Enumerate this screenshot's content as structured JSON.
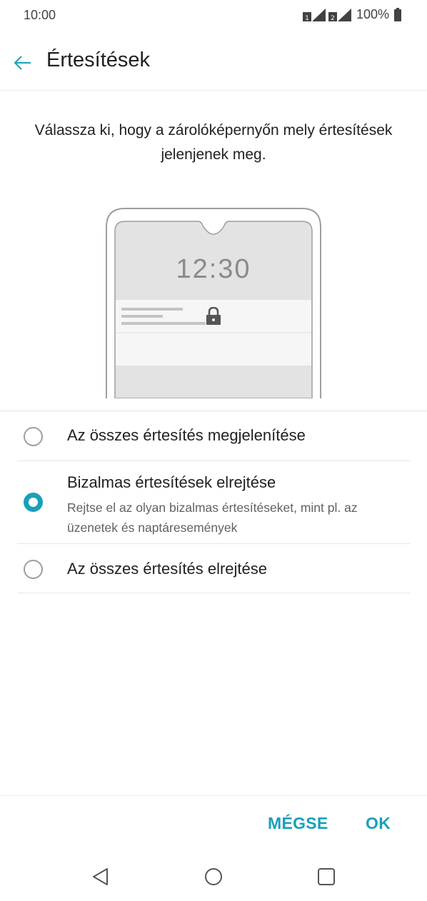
{
  "status_bar": {
    "time": "10:00",
    "sim1_label": "1",
    "sim2_label": "2",
    "battery": "100%",
    "icons": [
      "sim1-signal-icon",
      "sim2-signal-icon",
      "battery-full-icon"
    ]
  },
  "app_bar": {
    "title": "Értesítések",
    "back_icon": "arrow-left-icon"
  },
  "description": "Válassza ki, hogy a zárolóképernyőn mely értesítések jelenjenek meg.",
  "illustration": {
    "clock": "12:30",
    "lock_icon": "lock-icon"
  },
  "options": [
    {
      "label": "Az összes értesítés megjelenítése",
      "selected": false
    },
    {
      "label": "Bizalmas értesítések elrejtése",
      "sublabel": "Rejtse el az olyan bizalmas értesítéseket, mint pl. az üzenetek és naptáresemények",
      "selected": true
    },
    {
      "label": "Az összes értesítés elrejtése",
      "selected": false
    }
  ],
  "actions": {
    "cancel": "MÉGSE",
    "ok": "OK"
  },
  "nav_bar": {
    "icons": [
      "back-triangle-icon",
      "home-circle-icon",
      "recents-square-icon"
    ]
  },
  "colors": {
    "accent": "#1a9fba"
  }
}
